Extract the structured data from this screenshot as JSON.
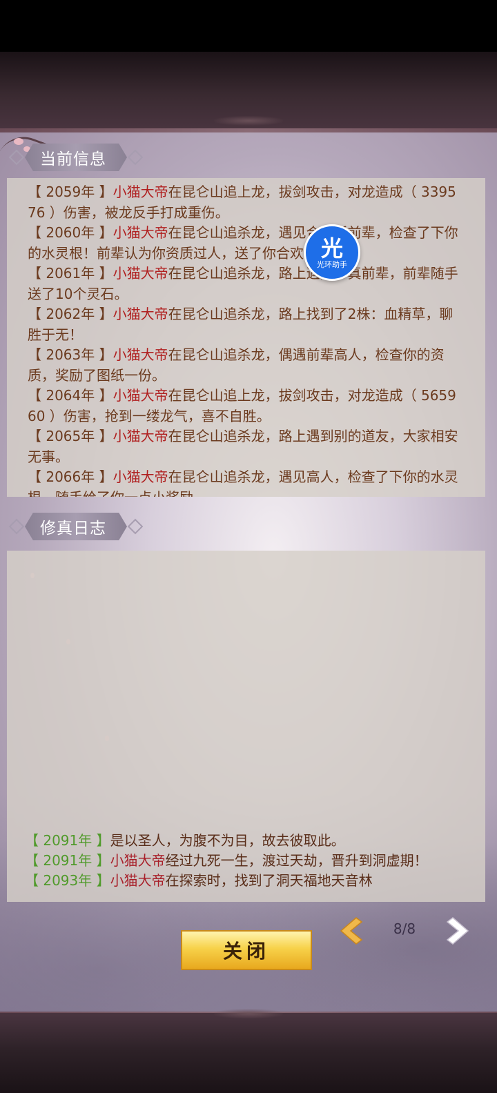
{
  "current_info": {
    "title": "当前信息",
    "entries": [
      {
        "year": "【 2059年 】",
        "name": "小猫大帝",
        "text": "在昆仑山追上龙，拔剑攻击，对龙造成（ 339576 ）伤害，被龙反手打成重伤。"
      },
      {
        "year": "【 2060年 】",
        "name": "小猫大帝",
        "text": "在昆仑山追杀龙，遇见合欢派前辈，检查了下你的水灵根！前辈认为你资质过人，送了你合欢派信物"
      },
      {
        "year": "【 2061年 】",
        "name": "小猫大帝",
        "text": "在昆仑山追杀龙，路上遇见修真前辈，前辈随手送了10个灵石。"
      },
      {
        "year": "【 2062年 】",
        "name": "小猫大帝",
        "text": "在昆仑山追杀龙，路上找到了2株：血精草，聊胜于无！"
      },
      {
        "year": "【 2063年 】",
        "name": "小猫大帝",
        "text": "在昆仑山追杀龙，偶遇前辈高人，检查你的资质，奖励了图纸一份。"
      },
      {
        "year": "【 2064年 】",
        "name": "小猫大帝",
        "text": "在昆仑山追上龙，拔剑攻击，对龙造成（ 565960 ）伤害，抢到一缕龙气，喜不自胜。"
      },
      {
        "year": "【 2065年 】",
        "name": "小猫大帝",
        "text": "在昆仑山追杀龙，路上遇到别的道友，大家相安无事。"
      },
      {
        "year": "【 2066年 】",
        "name": "小猫大帝",
        "text": "在昆仑山追杀龙，遇见高人，检查了下你的水灵根，随手给了你一点小奖励。"
      }
    ]
  },
  "cultivation_log": {
    "title": "修真日志",
    "entries": [
      {
        "year": "【 2091年 】",
        "name": "",
        "text": "是以圣人，为腹不为目，故去彼取此。"
      },
      {
        "year": "【 2091年 】",
        "name": "小猫大帝",
        "text": "经过九死一生，渡过天劫，晋升到洞虚期！"
      },
      {
        "year": "【 2093年 】",
        "name": "小猫大帝",
        "text": "在探索时，找到了洞天福地天音林"
      }
    ]
  },
  "overlay": {
    "glyph": "光",
    "caption": "光环助手"
  },
  "footer": {
    "close_label": "关闭",
    "page": "8/8"
  },
  "colors": {
    "name_red": "#b02020",
    "year_green": "#4f9a2a",
    "button_gold": "#f7d24a"
  }
}
